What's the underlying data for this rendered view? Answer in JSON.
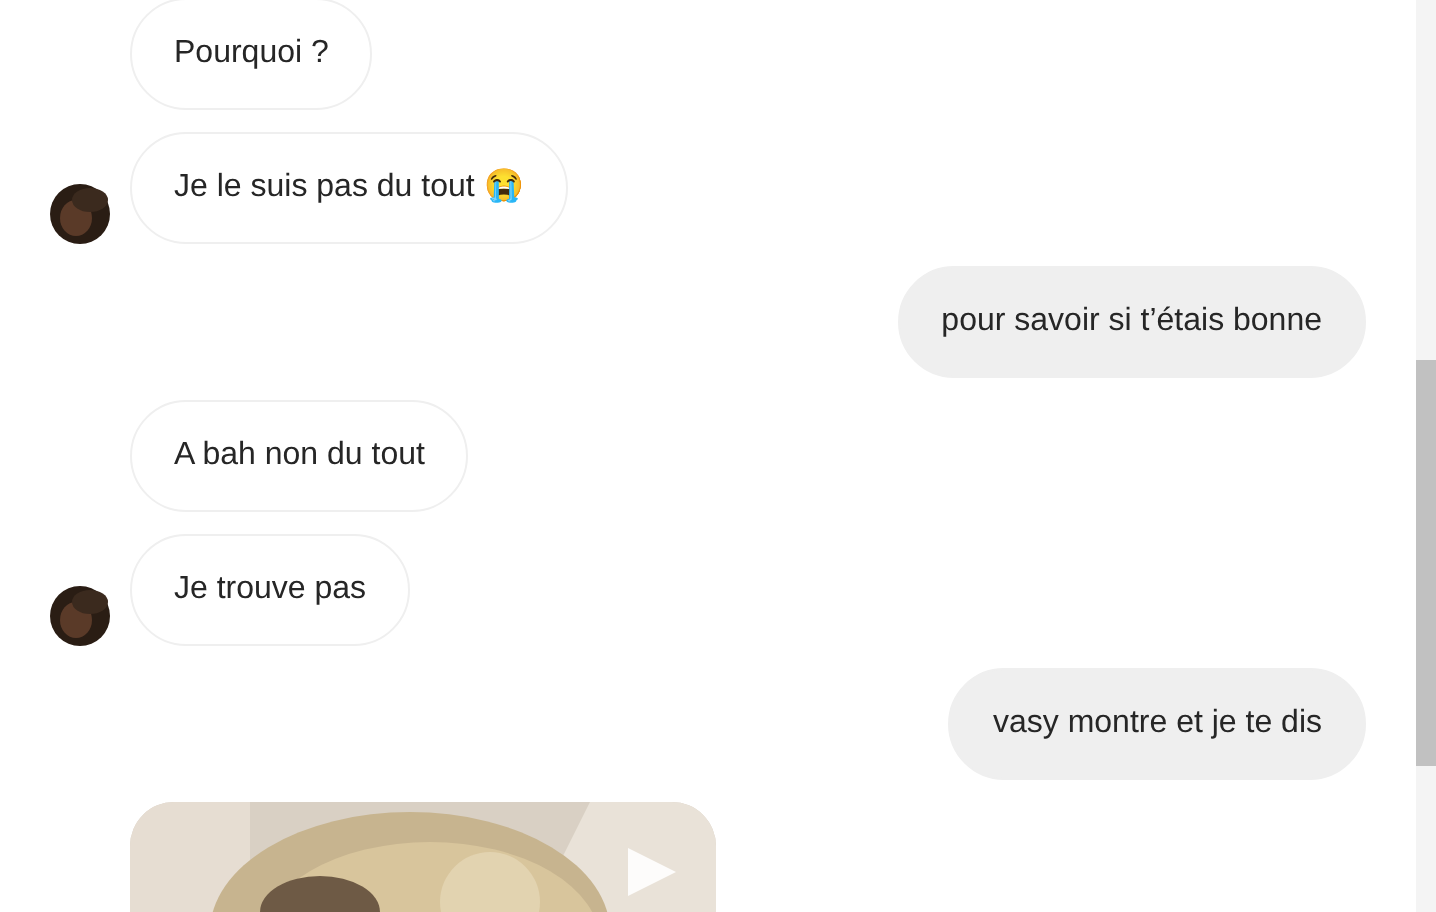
{
  "messages": [
    {
      "kind": "text",
      "outgoing": false,
      "avatar": false,
      "text": "Pourquoi ?"
    },
    {
      "kind": "text",
      "outgoing": false,
      "avatar": true,
      "text": "Je le suis pas du tout 😭"
    },
    {
      "kind": "text",
      "outgoing": true,
      "avatar": false,
      "text": "pour savoir si t’étais bonne"
    },
    {
      "kind": "text",
      "outgoing": false,
      "avatar": false,
      "text": "A bah non du tout"
    },
    {
      "kind": "text",
      "outgoing": false,
      "avatar": true,
      "text": "Je trouve pas"
    },
    {
      "kind": "text",
      "outgoing": true,
      "avatar": false,
      "text": "vasy montre et je te dis"
    },
    {
      "kind": "video",
      "outgoing": false,
      "avatar": false
    }
  ]
}
